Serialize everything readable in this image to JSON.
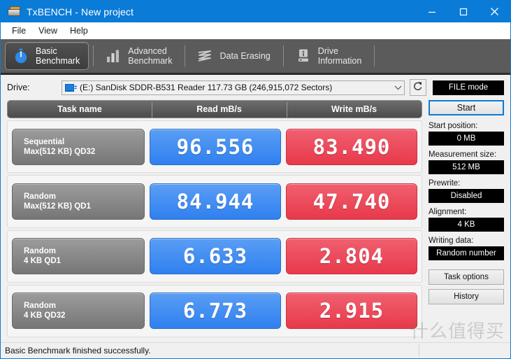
{
  "window": {
    "title": "TxBENCH - New project",
    "icon": "drive-icon",
    "controls": [
      {
        "name": "minimize-button",
        "glyph": "minimize-icon"
      },
      {
        "name": "maximize-button",
        "glyph": "maximize-icon"
      },
      {
        "name": "close-button",
        "glyph": "close-icon"
      }
    ]
  },
  "menu": {
    "items": [
      {
        "label": "File"
      },
      {
        "label": "View"
      },
      {
        "label": "Help"
      }
    ]
  },
  "tabs": [
    {
      "label": "Basic\nBenchmark",
      "icon": "stopwatch-icon",
      "active": true
    },
    {
      "label": "Advanced\nBenchmark",
      "icon": "bar-chart-icon",
      "active": false
    },
    {
      "label": "Data Erasing",
      "icon": "eraser-waves-icon",
      "active": false
    },
    {
      "label": "Drive\nInformation",
      "icon": "drive-info-icon",
      "active": false
    }
  ],
  "drivebar": {
    "label": "Drive:",
    "selected": "(E:) SanDisk SDDR-B531 Reader  117.73 GB (246,915,072 Sectors)",
    "combo_icon": "removable-drive-icon",
    "dropdown_icon": "chevron-down-icon",
    "refresh_icon": "refresh-icon",
    "mode_button": "FILE mode"
  },
  "results": {
    "columns": [
      "Task name",
      "Read mB/s",
      "Write mB/s"
    ],
    "rows": [
      {
        "task_line1": "Sequential",
        "task_line2": "Max(512 KB) QD32",
        "read": "96.556",
        "write": "83.490"
      },
      {
        "task_line1": "Random",
        "task_line2": "Max(512 KB) QD1",
        "read": "84.944",
        "write": "47.740"
      },
      {
        "task_line1": "Random",
        "task_line2": "4 KB QD1",
        "read": "6.633",
        "write": "2.804"
      },
      {
        "task_line1": "Random",
        "task_line2": "4 KB QD32",
        "read": "6.773",
        "write": "2.915"
      }
    ]
  },
  "sidebar": {
    "start_label": "Start",
    "fields": [
      {
        "label": "Start position:",
        "value": "0 MB"
      },
      {
        "label": "Measurement size:",
        "value": "512 MB"
      },
      {
        "label": "Prewrite:",
        "value": "Disabled"
      },
      {
        "label": "Alignment:",
        "value": "4 KB"
      },
      {
        "label": "Writing data:",
        "value": "Random number"
      }
    ],
    "buttons": [
      {
        "label": "Task options"
      },
      {
        "label": "History"
      }
    ]
  },
  "statusbar": {
    "message": "Basic Benchmark finished successfully."
  },
  "watermark": {
    "text": "什么值得买"
  },
  "colors": {
    "titlebar": "#0a7bd6",
    "read": "#2f80ef",
    "write": "#e8394b",
    "tabstrip": "#5b5b5b",
    "accent": "#0a7bd6"
  }
}
